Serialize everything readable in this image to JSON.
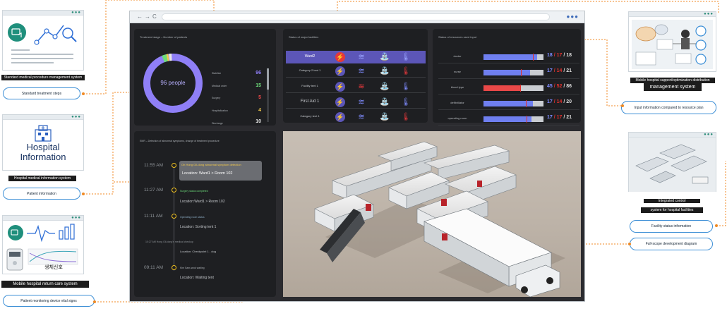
{
  "left_cards": {
    "card1": {
      "caption": "Standard medical procedure management system",
      "pill": "Standard treatment steps"
    },
    "card2": {
      "title_line1": "Hospital",
      "title_line2": "Information",
      "caption": "Hospital medical information system",
      "pill": "Patient information"
    },
    "card3": {
      "korean_label": "생체신호",
      "caption": "Mobile hospital return care system",
      "pill": "Patient monitoring device vital signs"
    }
  },
  "right_cards": {
    "card1": {
      "caption_line1": "Mobile hospital support/optimization distribution",
      "caption_line2": "management system",
      "pill": "Input information compared to resource plan"
    },
    "card2": {
      "caption_line1": "Integrated control",
      "caption_line2": "system for hospital facilities",
      "pill1": "Facility status information",
      "pill2": "Full-scope development diagram"
    }
  },
  "treatment": {
    "title": "Treatment stage – Number of patients",
    "donut_center": "96 people",
    "legend": [
      {
        "label": "Stabilize",
        "value": "96",
        "color": "#8f7ff7"
      },
      {
        "label": "Medical order",
        "value": "15",
        "color": "#6ddc7a"
      },
      {
        "label": "Surgery",
        "value": "5",
        "color": "#f04848"
      },
      {
        "label": "Hospitalization",
        "value": "4",
        "color": "#f2c94c"
      },
      {
        "label": "Discharge",
        "value": "10",
        "color": "#e8e8e8"
      }
    ]
  },
  "facilities": {
    "title": "Status of major facilities",
    "rows": [
      "Ward2",
      "Category 2 tent 1",
      "Facility tent 1",
      "First Aid 1",
      "Category tent 1"
    ]
  },
  "resources": {
    "title": "Status of resources used input",
    "rows": [
      {
        "label": "doctor",
        "a": "18",
        "b": "17",
        "c": "18",
        "fill": 0.89,
        "mark": 0.82,
        "color": "#6f7ff0"
      },
      {
        "label": "nurse",
        "a": "17",
        "b": "14",
        "c": "21",
        "fill": 0.78,
        "mark": 0.62,
        "color": "#6f7ff0"
      },
      {
        "label": "blood type",
        "a": "45",
        "b": "52",
        "c": "86",
        "fill": 0.61,
        "mark": 0.61,
        "color": "#e84848"
      },
      {
        "label": "defibrillator",
        "a": "17",
        "b": "14",
        "c": "20",
        "fill": 0.82,
        "mark": 0.71,
        "color": "#6f7ff0"
      },
      {
        "label": "operating room",
        "a": "17",
        "b": "17",
        "c": "21",
        "fill": 0.8,
        "mark": 0.72,
        "color": "#6f7ff0"
      }
    ]
  },
  "emr": {
    "title": "EMR – Detection of abnormal symptoms, change of treatment procedure",
    "events": [
      {
        "time": "11:55 AM",
        "note": "Oh Hong Gil-dong abnormal symptom detection",
        "location": "Location: Ward1 > Room 102"
      },
      {
        "time": "11:27 AM",
        "note": "Surgery status completed",
        "location": "Location:Ward1 > Room 102"
      },
      {
        "time": "11:11 AM",
        "note": "Operating room status",
        "location": "Location: Sorting tent 1"
      },
      {
        "time": "",
        "note": "10:27 AM Hong Gil-dong's medical checkup",
        "location": "Location: Checkpoint 1 - dog"
      },
      {
        "time": "09:11 AM",
        "note": "Kim Sam-seok waiting",
        "location": "Location: Waiting tent"
      }
    ]
  }
}
